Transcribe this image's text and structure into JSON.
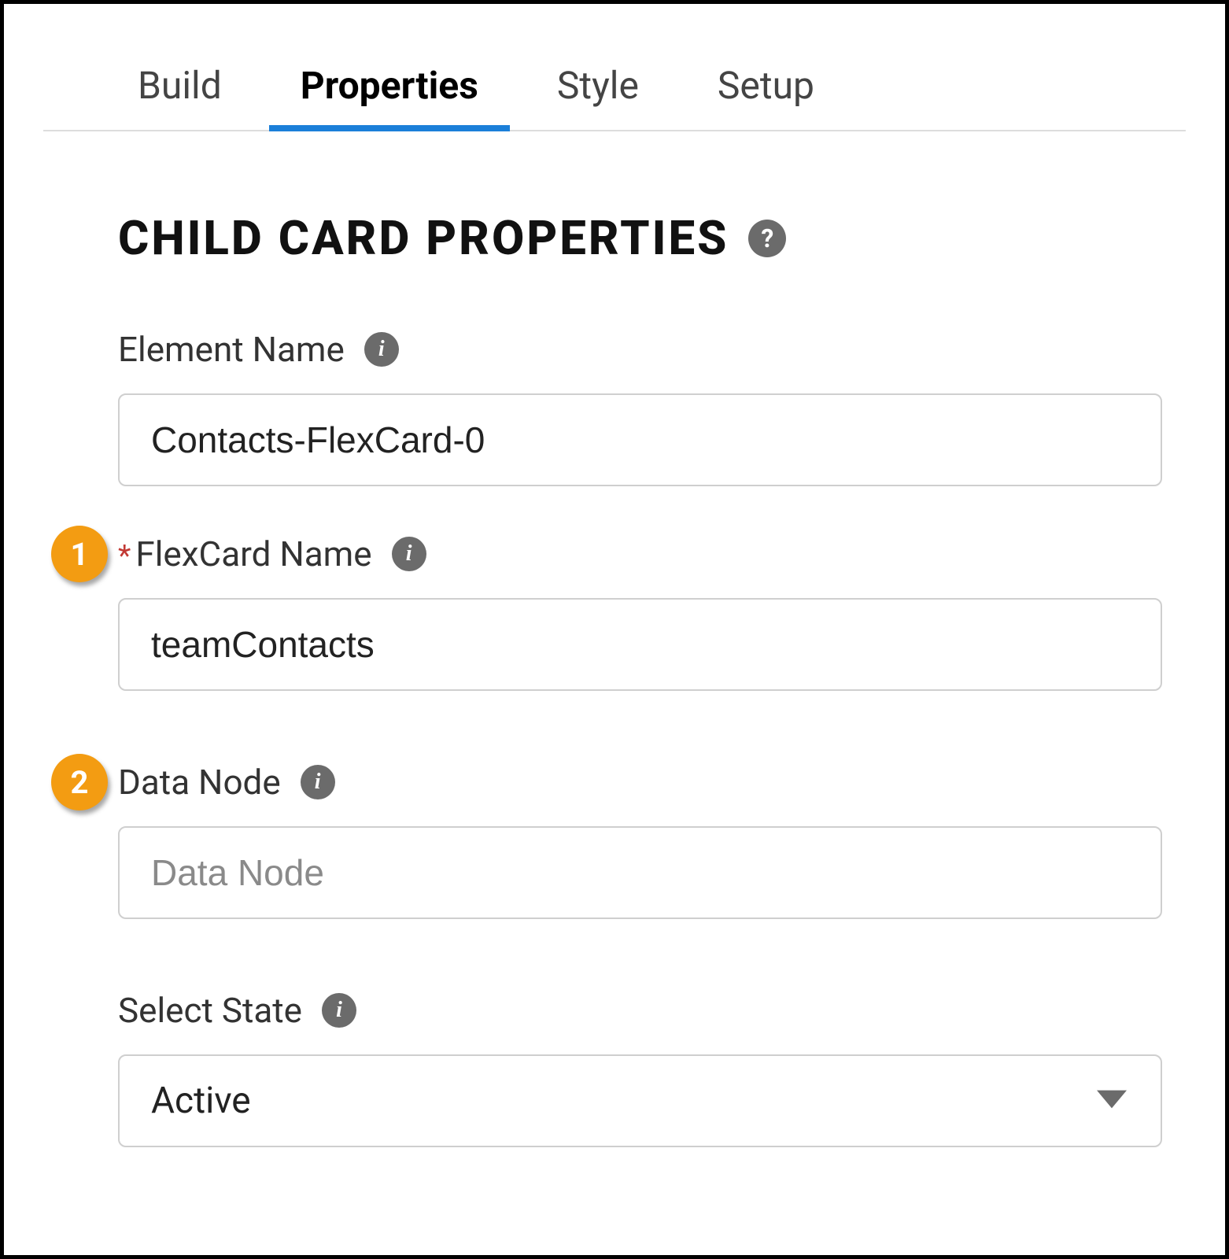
{
  "tabs": {
    "build": "Build",
    "properties": "Properties",
    "style": "Style",
    "setup": "Setup",
    "active": "properties"
  },
  "section": {
    "title": "CHILD CARD PROPERTIES"
  },
  "fields": {
    "elementName": {
      "label": "Element Name",
      "value": "Contacts-FlexCard-0",
      "required": false
    },
    "flexcardName": {
      "label": "FlexCard Name",
      "value": "teamContacts",
      "required": true
    },
    "dataNode": {
      "label": "Data Node",
      "value": "",
      "placeholder": "Data Node",
      "required": false
    },
    "selectState": {
      "label": "Select State",
      "value": "Active",
      "required": false
    }
  },
  "callouts": {
    "one": "1",
    "two": "2"
  }
}
